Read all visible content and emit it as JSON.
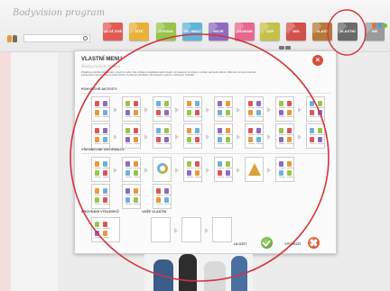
{
  "app": {
    "title": "Bodyvision program"
  },
  "search": {
    "placeholder": ""
  },
  "tabs": [
    {
      "label": "ULOŽ SVÉ",
      "color": "#e25b54"
    },
    {
      "label": "ŠÍTE",
      "color": "#e9b13a"
    },
    {
      "label": "STRAVA",
      "color": "#98c44b"
    },
    {
      "label": "TĚL HMOT",
      "color": "#62b3d9"
    },
    {
      "label": "MOJE",
      "color": "#8e6bbf"
    },
    {
      "label": "ZÁZNAM",
      "color": "#e8678f"
    },
    {
      "label": "ZDR",
      "color": "#c5c04a"
    },
    {
      "label": "MIG",
      "color": "#d4504a"
    },
    {
      "label": "VLAST",
      "color": "#b57a3a"
    },
    {
      "label": "VLASTNÍ MENU",
      "color": "#6a6a6a"
    },
    {
      "label": "INE",
      "color": "#9a9a9a"
    }
  ],
  "status_colors": [
    "#e8702b",
    "#4aa0d8",
    "#7aba3e"
  ],
  "modal": {
    "title": "VLASTNÍ MENU",
    "subtitle": "Bodyvision menu",
    "instructions": "Přetáhnou položku dolů do šetu. vytvořit si nebo. Zde můžete si naskládat vlastní obsah. Je nastavení se zobrazí v pořadí, jak bude uloženo. Kliknutím na ikonu začněte\nvybrat před možnou volbu na pravé straně. S přepnutí položkami. Na dostupné vyberte z uložených výsledků.",
    "sections": {
      "activities": "POHYBOVÉ AKTIVITY",
      "general": "VŠEOBECNÉ INFORMACE",
      "compare": "SROVNÁNÍ VÝSLEDKŮ",
      "custom": "VAŠE VLASTNÍ"
    },
    "ok_label": "ULOŽIT",
    "reset_label": "VÝCHOZÍ"
  }
}
